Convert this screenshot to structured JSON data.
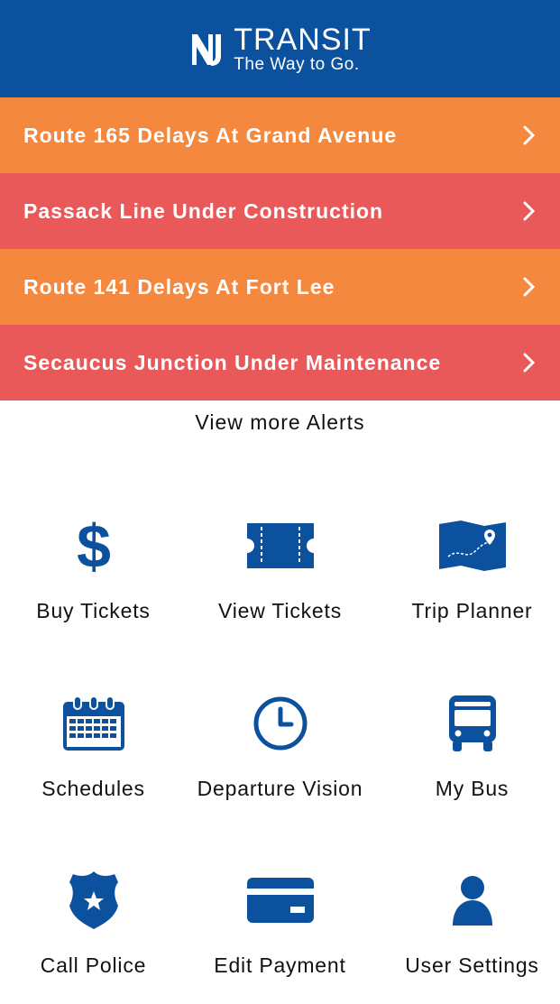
{
  "header": {
    "logo_mark": "NJ",
    "logo_title": "TRANSIT",
    "tagline": "The Way to Go."
  },
  "alerts": [
    {
      "label": "Route 165 Delays At Grand Avenue",
      "color": "#f4883f"
    },
    {
      "label": "Passack Line Under Construction",
      "color": "#e9595a"
    },
    {
      "label": "Route 141 Delays At Fort Lee",
      "color": "#f4883f"
    },
    {
      "label": "Secaucus Junction Under Maintenance",
      "color": "#e9595a"
    }
  ],
  "view_more_label": "View more Alerts",
  "tiles": [
    {
      "label": "Buy Tickets",
      "icon": "dollar-icon"
    },
    {
      "label": "View Tickets",
      "icon": "ticket-icon"
    },
    {
      "label": "Trip Planner",
      "icon": "map-icon"
    },
    {
      "label": "Schedules",
      "icon": "calendar-icon"
    },
    {
      "label": "Departure Vision",
      "icon": "clock-icon"
    },
    {
      "label": "My Bus",
      "icon": "bus-icon"
    },
    {
      "label": "Call Police",
      "icon": "police-badge-icon"
    },
    {
      "label": "Edit Payment",
      "icon": "credit-card-icon"
    },
    {
      "label": "User Settings",
      "icon": "user-icon"
    }
  ],
  "colors": {
    "brand_blue": "#0b519e",
    "alert_orange": "#f4883f",
    "alert_red": "#e9595a"
  }
}
